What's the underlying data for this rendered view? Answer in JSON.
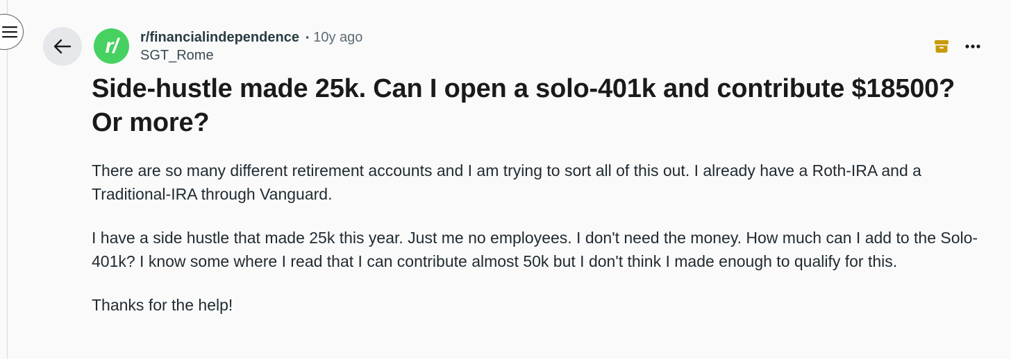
{
  "nav": {
    "menu_icon": "hamburger-menu-icon",
    "back_icon": "arrow-left-icon"
  },
  "post": {
    "subreddit_avatar_text": "r/",
    "subreddit": "r/financialindependence",
    "separator": "•",
    "age": "10y ago",
    "author": "SGT_Rome",
    "archived_icon": "archive-box-icon",
    "more_icon": "more-options-icon",
    "title": "Side-hustle made 25k. Can I open a solo-401k and contribute $18500? Or more?",
    "body_paragraphs": [
      "There are so many different retirement accounts and I am trying to sort all of this out. I already have a Roth-IRA and a Traditional-IRA through Vanguard.",
      "I have a side hustle that made 25k this year. Just me no employees. I don't need the money. How much can I add to the Solo-401k? I know some where I read that I can contribute almost 50k but I don't think I made enough to qualify for this.",
      "Thanks for the help!"
    ]
  },
  "colors": {
    "background": "#fafafb",
    "avatar_green": "#46d160",
    "archive_gold": "#c79a06",
    "back_button_bg": "#e5e7ea",
    "text_primary": "#1a1a1b",
    "text_secondary": "#5c6c74"
  }
}
